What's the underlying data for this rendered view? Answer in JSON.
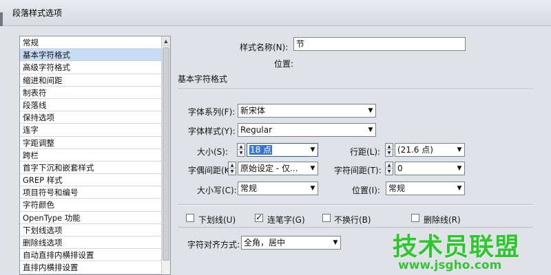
{
  "window": {
    "title": "段落样式选项"
  },
  "categories": [
    {
      "label": "常规"
    },
    {
      "label": "基本字符格式",
      "selected": true
    },
    {
      "label": "高级字符格式"
    },
    {
      "label": "缩进和间距"
    },
    {
      "label": "制表符"
    },
    {
      "label": "段落线"
    },
    {
      "label": "保持选项"
    },
    {
      "label": "连字"
    },
    {
      "label": "字距调整"
    },
    {
      "label": "跨栏"
    },
    {
      "label": "首字下沉和嵌套样式"
    },
    {
      "label": "GREP 样式"
    },
    {
      "label": "项目符号和编号"
    },
    {
      "label": "字符颜色"
    },
    {
      "label": "OpenType 功能"
    },
    {
      "label": "下划线选项"
    },
    {
      "label": "删除线选项"
    },
    {
      "label": "自动直排内横排设置"
    },
    {
      "label": "直排内横排设置"
    }
  ],
  "style_name": {
    "label": "样式名称(N):",
    "value": "节"
  },
  "location": {
    "label": "位置:"
  },
  "section_title": "基本字符格式",
  "fields": {
    "font_family": {
      "label": "字体系列(F):",
      "value": "新宋体"
    },
    "font_style": {
      "label": "字体样式(Y):",
      "value": "Regular"
    },
    "size": {
      "label": "大小(S):",
      "value": "18 点"
    },
    "leading": {
      "label": "行距(L):",
      "value": "(21.6 点)"
    },
    "kerning": {
      "label": "字偶间距(K):",
      "value": "原始设定 - 仅..."
    },
    "tracking": {
      "label": "字符间距(T):",
      "value": "0"
    },
    "case": {
      "label": "大小写(C):",
      "value": "常规"
    },
    "position": {
      "label": "位置(I):",
      "value": "常规"
    }
  },
  "checkboxes": [
    {
      "label": "下划线(U)",
      "checked": false
    },
    {
      "label": "连笔字(G)",
      "checked": true
    },
    {
      "label": "不换行(B)",
      "checked": false
    },
    {
      "label": "删除线(R)",
      "checked": false
    }
  ],
  "alignment": {
    "label": "字符对齐方式:",
    "value": "全角，居中"
  },
  "watermark": {
    "main": "技术员联盟",
    "sub": "www.jsgho.com"
  },
  "colors": {
    "selected_item": "#c7dcf5",
    "highlight": "#3875d7",
    "watermark": "#2ec72e"
  }
}
